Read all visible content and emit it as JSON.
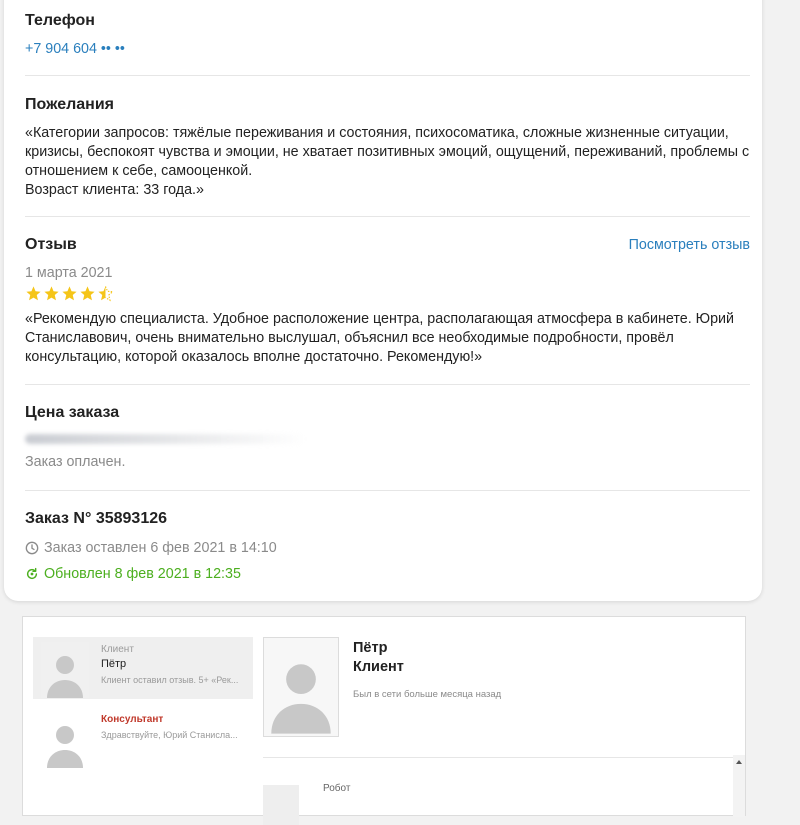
{
  "order": {
    "phone_heading": "Телефон",
    "phone_value": "+7 904 604 •• ••",
    "wishes_heading": "Пожелания",
    "wishes_text": "«Категории запросов: тяжёлые переживания и состояния, психосоматика, сложные жизненные ситуации, кризисы, беспокоят чувства и эмоции, не хватает позитивных эмоций, ощущений, переживаний, проблемы с отношением к себе, самооценкой.",
    "wishes_age": "Возраст клиента: 33 года.»",
    "review_heading": "Отзыв",
    "review_link": "Посмотреть отзыв",
    "review_date": "1 марта 2021",
    "review_rating": 4.5,
    "review_text": "«Рекомендую специалиста. Удобное расположение центра, располагающая атмосфера в кабинете. Юрий Станиславович, очень внимательно выслушал, объяснил все необходимые подробности, провёл консультацию, которой оказалось вполне достаточно. Рекомендую!»",
    "price_heading": "Цена заказа",
    "price_status": "Заказ оплачен.",
    "order_number": "Заказ N° 35893126",
    "created_text": "Заказ оставлен 6 фев 2021 в 14:10",
    "updated_text": "Обновлен 8 фев 2021 в 12:35",
    "accent_link": "#2a7fbd",
    "accent_green": "#4caf1f",
    "star_color": "#f5c518"
  },
  "chat": {
    "items": [
      {
        "role": "Клиент",
        "name": "Пётр",
        "preview": "Клиент оставил отзыв. 5+ «Рек...",
        "active": true
      },
      {
        "role": "Консультант",
        "name": "",
        "preview": "Здравствуйте, Юрий Станисла..."
      }
    ],
    "profile_name": "Пётр",
    "profile_role": "Клиент",
    "profile_status": "Был в сети больше месяца назад",
    "robot_label": "Робот"
  }
}
